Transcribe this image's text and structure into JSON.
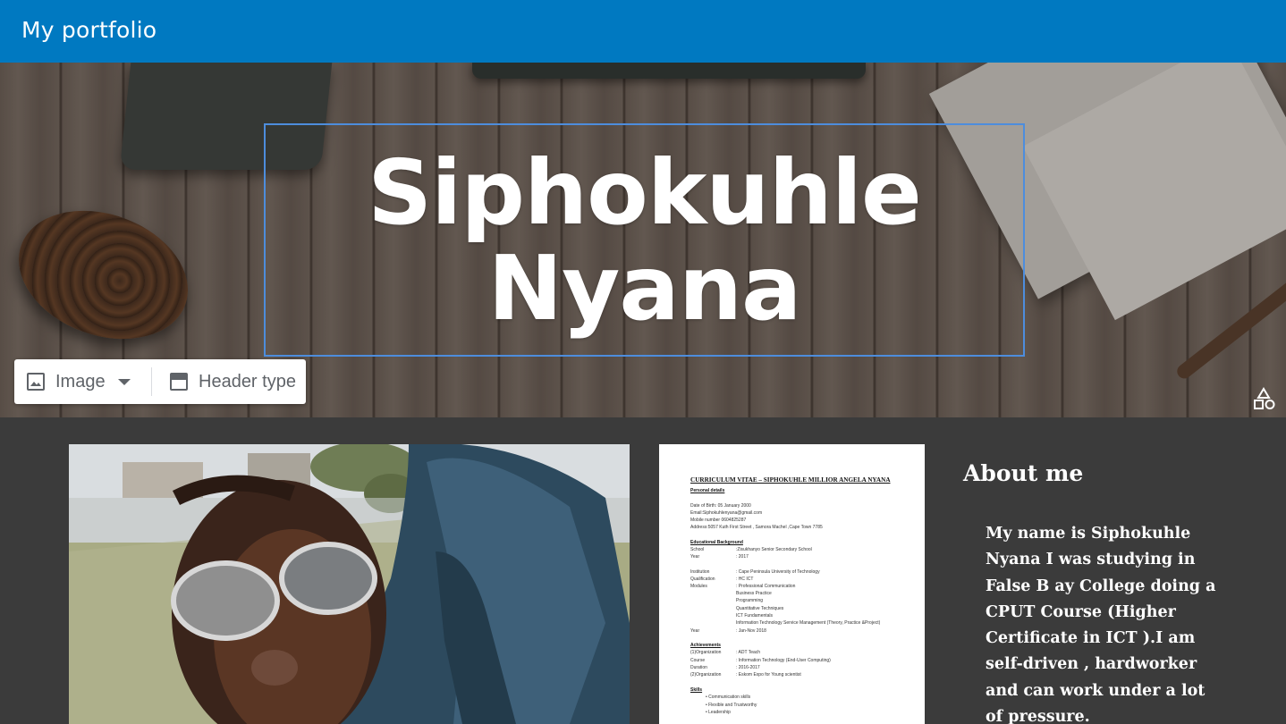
{
  "app": {
    "title": "My portfolio",
    "accent_color": "#0079c1"
  },
  "header": {
    "name_line1": "Siphokuhle",
    "name_line2": "Nyana",
    "toolbar": {
      "image_label": "Image",
      "image_icon": "image-icon",
      "header_type_label": "Header type",
      "header_type_icon": "header-type-icon"
    },
    "theme_icon": "shapes-icon"
  },
  "cv": {
    "title": "CURRICULUM VITAE – SIPHOKUHLE MILLIOR ANGELA NYANA",
    "lines": [
      {
        "t": "Personal details",
        "k": "h"
      },
      {
        "t": "Date of Birth: 05 January 2000",
        "k": ""
      },
      {
        "t": "Email:Siphokuhlenyana@gmail.com",
        "k": ""
      },
      {
        "t": "Mobile number 0604825287",
        "k": ""
      },
      {
        "t": "Address:5057 Kuth First Street , Samora Machel ,Cape Town 7785",
        "k": ""
      },
      {
        "t": "Educational Background",
        "k": "h"
      },
      {
        "t": "School",
        "k": ""
      },
      {
        "t": ":Zisukhanyo Senior Secondary School",
        "k": "in"
      },
      {
        "t": "Year",
        "k": ""
      },
      {
        "t": ": 2017",
        "k": "in"
      },
      {
        "t": "Institution",
        "k": ""
      },
      {
        "t": ": Cape Peninsula University of Technology",
        "k": "in"
      },
      {
        "t": "Qualification",
        "k": ""
      },
      {
        "t": ": HC ICT",
        "k": "in"
      },
      {
        "t": "Modules",
        "k": ""
      },
      {
        "t": ": Professional Communication",
        "k": "in"
      },
      {
        "t": "Business Practice",
        "k": "in"
      },
      {
        "t": "Programming",
        "k": "in"
      },
      {
        "t": "Quantitative Techniques",
        "k": "in"
      },
      {
        "t": "ICT Fundamentals",
        "k": "in"
      },
      {
        "t": "Information Technology Service Management (Theory, Practice &Project)",
        "k": "in"
      },
      {
        "t": "Year",
        "k": ""
      },
      {
        "t": ": Jan-Nov 2018",
        "k": "in"
      },
      {
        "t": "Achievements",
        "k": "h"
      },
      {
        "t": "(1)Organization",
        "k": ""
      },
      {
        "t": ": ADT Teach",
        "k": "in"
      },
      {
        "t": "Course",
        "k": ""
      },
      {
        "t": ": Information Technology (End-User Computing)",
        "k": "in"
      },
      {
        "t": "Duration",
        "k": ""
      },
      {
        "t": ": 2016-2017",
        "k": "in"
      },
      {
        "t": "(2)Organization",
        "k": ""
      },
      {
        "t": ": Eskom Expo for Young scientist",
        "k": "in"
      },
      {
        "t": "Skills",
        "k": "h"
      },
      {
        "t": "•   Communication skills",
        "k": "bul"
      },
      {
        "t": "•   Flexible and Trustworthy",
        "k": "bul"
      },
      {
        "t": "•   Leadership",
        "k": "bul"
      }
    ]
  },
  "about": {
    "heading": "About me",
    "text": "My name is Siphokuhle Nyana I was studying in False B ay College doing a CPUT Course (Higher Certificate in ICT ).I am self-driven , hardworker and can work under a lot of pressure."
  }
}
